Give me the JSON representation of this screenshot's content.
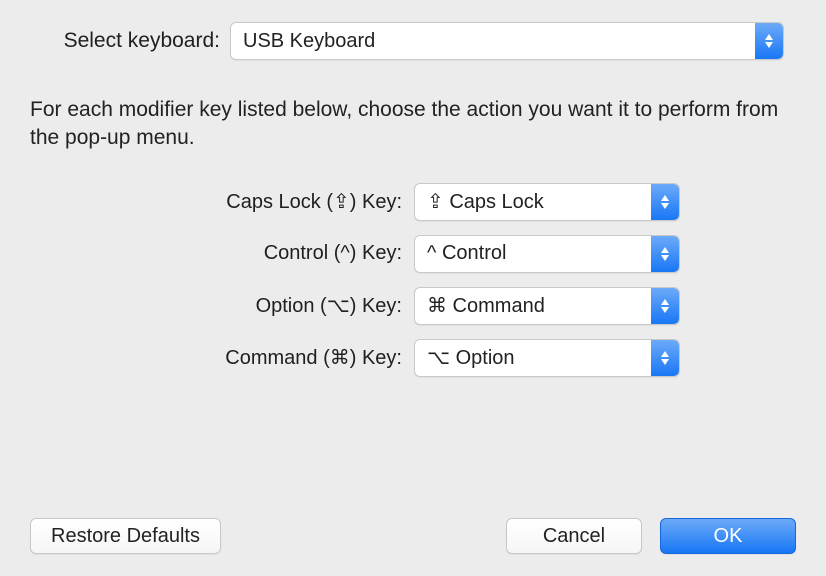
{
  "keyboard_select": {
    "label": "Select keyboard:",
    "value": "USB Keyboard"
  },
  "instructions": "For each modifier key listed below, choose the action you want it to perform from the pop-up menu.",
  "mappings": [
    {
      "label": "Caps Lock (⇪) Key:",
      "value": "⇪ Caps Lock"
    },
    {
      "label": "Control (^) Key:",
      "value": "^ Control"
    },
    {
      "label": "Option (⌥) Key:",
      "value": "⌘ Command"
    },
    {
      "label": "Command (⌘) Key:",
      "value": "⌥ Option"
    }
  ],
  "buttons": {
    "restore": "Restore Defaults",
    "cancel": "Cancel",
    "ok": "OK"
  }
}
